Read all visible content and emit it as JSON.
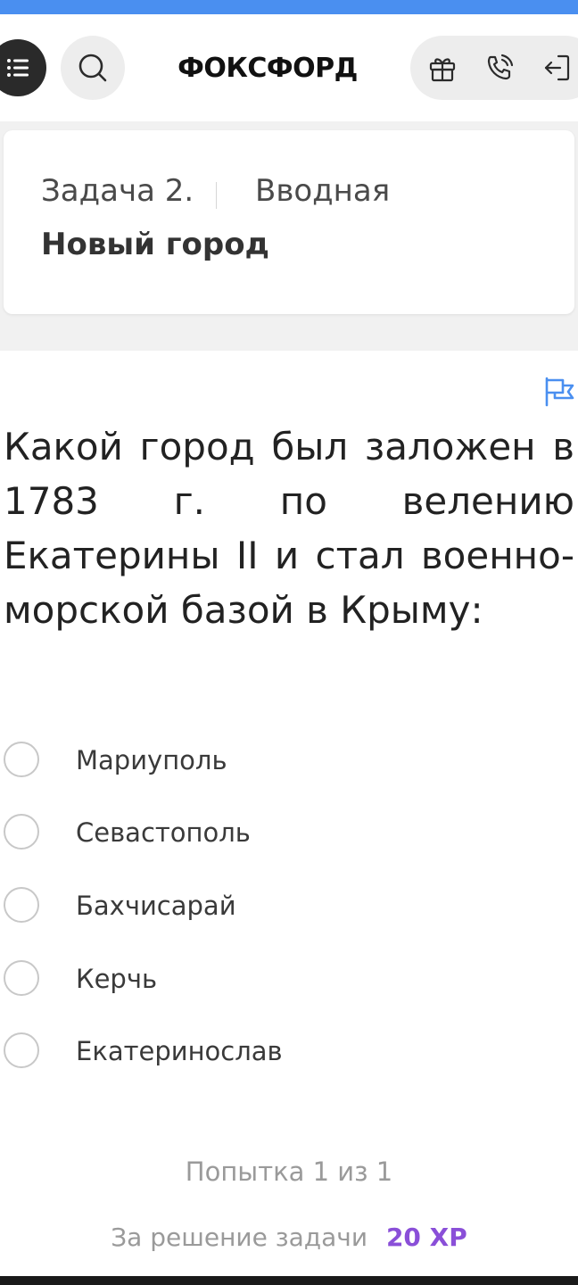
{
  "header": {
    "logo": "ФОКСФОРД",
    "icons": [
      "menu-icon",
      "search-icon",
      "gift-icon",
      "phone-icon",
      "login-icon"
    ]
  },
  "task": {
    "number": "Задача 2.",
    "type": "Вводная",
    "title": "Новый город"
  },
  "question": {
    "text": "Какой город был заложен в 1783 г. по велению Екатерины II и стал военно-морской базой в Крыму:",
    "options": [
      {
        "label": "Мариуполь",
        "selected": false
      },
      {
        "label": "Севастополь",
        "selected": false
      },
      {
        "label": "Бахчисарай",
        "selected": false
      },
      {
        "label": "Керчь",
        "selected": false
      },
      {
        "label": "Екатеринослав",
        "selected": false
      }
    ]
  },
  "footer": {
    "attempts": "Попытка 1 из 1",
    "reward_label": "За решение задачи",
    "reward_value": "20 XP"
  },
  "colors": {
    "accent": "#4a8ff0",
    "xp": "#8a4fd8",
    "menu_button": "#2a2a2a"
  }
}
